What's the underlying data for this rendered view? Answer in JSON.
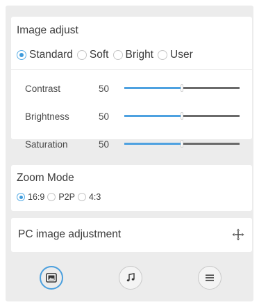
{
  "image_adjust": {
    "title": "Image adjust",
    "modes": [
      {
        "label": "Standard",
        "selected": true
      },
      {
        "label": "Soft",
        "selected": false
      },
      {
        "label": "Bright",
        "selected": false
      },
      {
        "label": "User",
        "selected": false
      }
    ],
    "sliders": [
      {
        "label": "Contrast",
        "value": "50",
        "level": 50
      },
      {
        "label": "Brightness",
        "value": "50",
        "level": 50
      },
      {
        "label": "Saturation",
        "value": "50",
        "level": 50
      }
    ]
  },
  "zoom": {
    "title": "Zoom Mode",
    "options": [
      {
        "label": "16:9",
        "selected": true
      },
      {
        "label": "P2P",
        "selected": false
      },
      {
        "label": "4:3",
        "selected": false
      }
    ]
  },
  "pc": {
    "label": "PC image adjustment",
    "icon": "move-icon"
  },
  "bottom_bar": {
    "buttons": [
      {
        "icon": "image-icon",
        "active": true
      },
      {
        "icon": "music-note-icon",
        "active": false
      },
      {
        "icon": "menu-icon",
        "active": false
      }
    ]
  },
  "colors": {
    "accent": "#4ea1e0",
    "panel": "#ececec",
    "card": "#ffffff",
    "track": "#6a6a6a"
  }
}
